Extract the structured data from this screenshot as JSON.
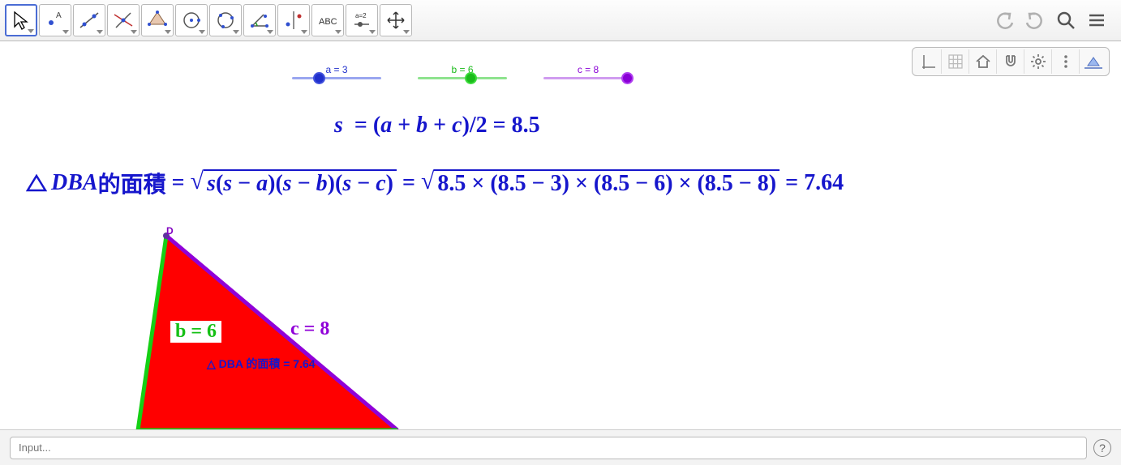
{
  "toolbar": {
    "tools": [
      "move",
      "point",
      "line",
      "perpendicular",
      "polygon",
      "circle",
      "circle3",
      "angle",
      "reflect",
      "text",
      "slider",
      "pan"
    ]
  },
  "sliders": {
    "a": {
      "label": "a = 3",
      "value": 3,
      "min": 0,
      "max": 10,
      "color": "#2030cc",
      "track": "#9aa6f0"
    },
    "b": {
      "label": "b = 6",
      "value": 6,
      "min": 0,
      "max": 10,
      "color": "#1bbb1b",
      "track": "#8ee38e"
    },
    "c": {
      "label": "c = 8",
      "value": 8,
      "min": 0,
      "max": 10,
      "color": "#8a00d6",
      "track": "#d09cf0"
    }
  },
  "formulas": {
    "s_text_pre": "s",
    "s_eq1": "=",
    "s_expr": "(a + b + c)/2",
    "s_eq2": "=",
    "s_value": "8.5",
    "area_lhs_tri": "DBA",
    "area_lhs_cn": "的面積",
    "area_eq1": "=",
    "heron_sym": "s(s − a)(s − b)(s − c)",
    "area_eq2": "=",
    "heron_num": "8.5 × (8.5 − 3) × (8.5 − 6) × (8.5 − 8)",
    "area_eq3": "=",
    "area_value": "7.64"
  },
  "triangle": {
    "vertex_d": "D",
    "side_b": "b = 6",
    "side_c": "c = 8",
    "area_text": "△ DBA 的面積 = 7.64"
  },
  "input": {
    "placeholder": "Input..."
  },
  "chart_data": {
    "type": "diagram",
    "description": "Heron's formula demonstration with triangle DBA",
    "parameters": {
      "a": 3,
      "b": 6,
      "c": 8,
      "s": 8.5,
      "area": 7.64
    },
    "formula": "Area = sqrt(s(s-a)(s-b)(s-c))",
    "triangle_vertices_approx": {
      "D": [
        205,
        285
      ],
      "B_direction": "lower-left",
      "A_direction": "lower-right"
    }
  }
}
